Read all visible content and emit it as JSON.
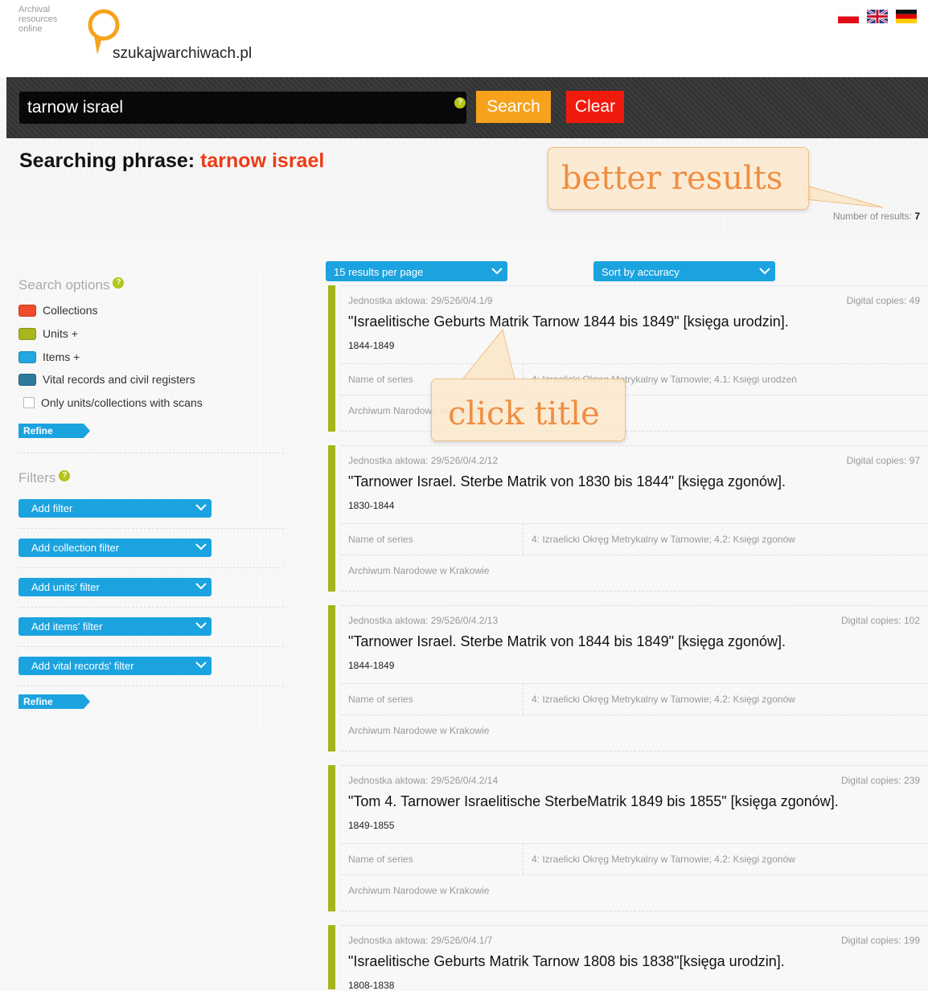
{
  "header": {
    "tagline": "Archival\nresources\nonline",
    "site_name": "szukajwarchiwach.pl",
    "languages": [
      "Polish",
      "English",
      "German"
    ]
  },
  "search": {
    "query": "tarnow israel",
    "search_label": "Search",
    "clear_label": "Clear"
  },
  "phrase": {
    "label": "Searching phrase: ",
    "term": "tarnow israel"
  },
  "results_count": {
    "label": "Number of results:",
    "value": "7"
  },
  "annotations": {
    "better": "better results",
    "click": "click title"
  },
  "controls": {
    "per_page": "15 results per page",
    "sort": "Sort by accuracy"
  },
  "sidebar": {
    "search_options_title": "Search options",
    "options": [
      {
        "label": "Collections",
        "color": "#f04b2a"
      },
      {
        "label": "Units +",
        "color": "#a9b61c"
      },
      {
        "label": "Items +",
        "color": "#22a7e0"
      },
      {
        "label": "Vital records and civil registers",
        "color": "#2d7a9c"
      }
    ],
    "only_scans": "Only units/collections with scans",
    "refine": "Refine",
    "filters_title": "Filters",
    "filters": [
      "Add filter",
      "Add collection filter",
      "Add units' filter",
      "Add items' filter",
      "Add vital records' filter"
    ]
  },
  "results": [
    {
      "code": "Jednostka aktowa: 29/526/0/4.1/9",
      "copies": "Digital copies: 49",
      "title": "\"Israelitische Geburts Matrik Tarnow 1844 bis 1849\" [księga urodzin].",
      "date": "1844-1849",
      "series_label": "Name of series",
      "series": "4: Izraelicki Okręg Metrykalny w Tarnowie; 4.1: Księgi urodzeń",
      "archive": "Archiwum Narodowe w Krakowie"
    },
    {
      "code": "Jednostka aktowa: 29/526/0/4.2/12",
      "copies": "Digital copies: 97",
      "title": "\"Tarnower Israel. Sterbe Matrik von 1830 bis 1844\" [księga zgonów].",
      "date": "1830-1844",
      "series_label": "Name of series",
      "series": "4: Izraelicki Okręg Metrykalny w Tarnowie; 4.2: Księgi zgonów",
      "archive": "Archiwum Narodowe w Krakowie"
    },
    {
      "code": "Jednostka aktowa: 29/526/0/4.2/13",
      "copies": "Digital copies: 102",
      "title": "\"Tarnower Israel. Sterbe Matrik von 1844 bis 1849\" [księga zgonów].",
      "date": "1844-1849",
      "series_label": "Name of series",
      "series": "4: Izraelicki Okręg Metrykalny w Tarnowie; 4.2: Księgi zgonów",
      "archive": "Archiwum Narodowe w Krakowie"
    },
    {
      "code": "Jednostka aktowa: 29/526/0/4.2/14",
      "copies": "Digital copies: 239",
      "title": "\"Tom 4. Tarnower Israelitische SterbeMatrik 1849 bis 1855\" [księga zgonów].",
      "date": "1849-1855",
      "series_label": "Name of series",
      "series": "4: Izraelicki Okręg Metrykalny w Tarnowie; 4.2: Księgi zgonów",
      "archive": "Archiwum Narodowe w Krakowie"
    },
    {
      "code": "Jednostka aktowa: 29/526/0/4.1/7",
      "copies": "Digital copies: 199",
      "title": "\"Israelitische Geburts Matrik Tarnow 1808 bis 1838\"[księga urodzin].",
      "date": "1808-1838",
      "series_label": "",
      "series": "",
      "archive": ""
    }
  ]
}
